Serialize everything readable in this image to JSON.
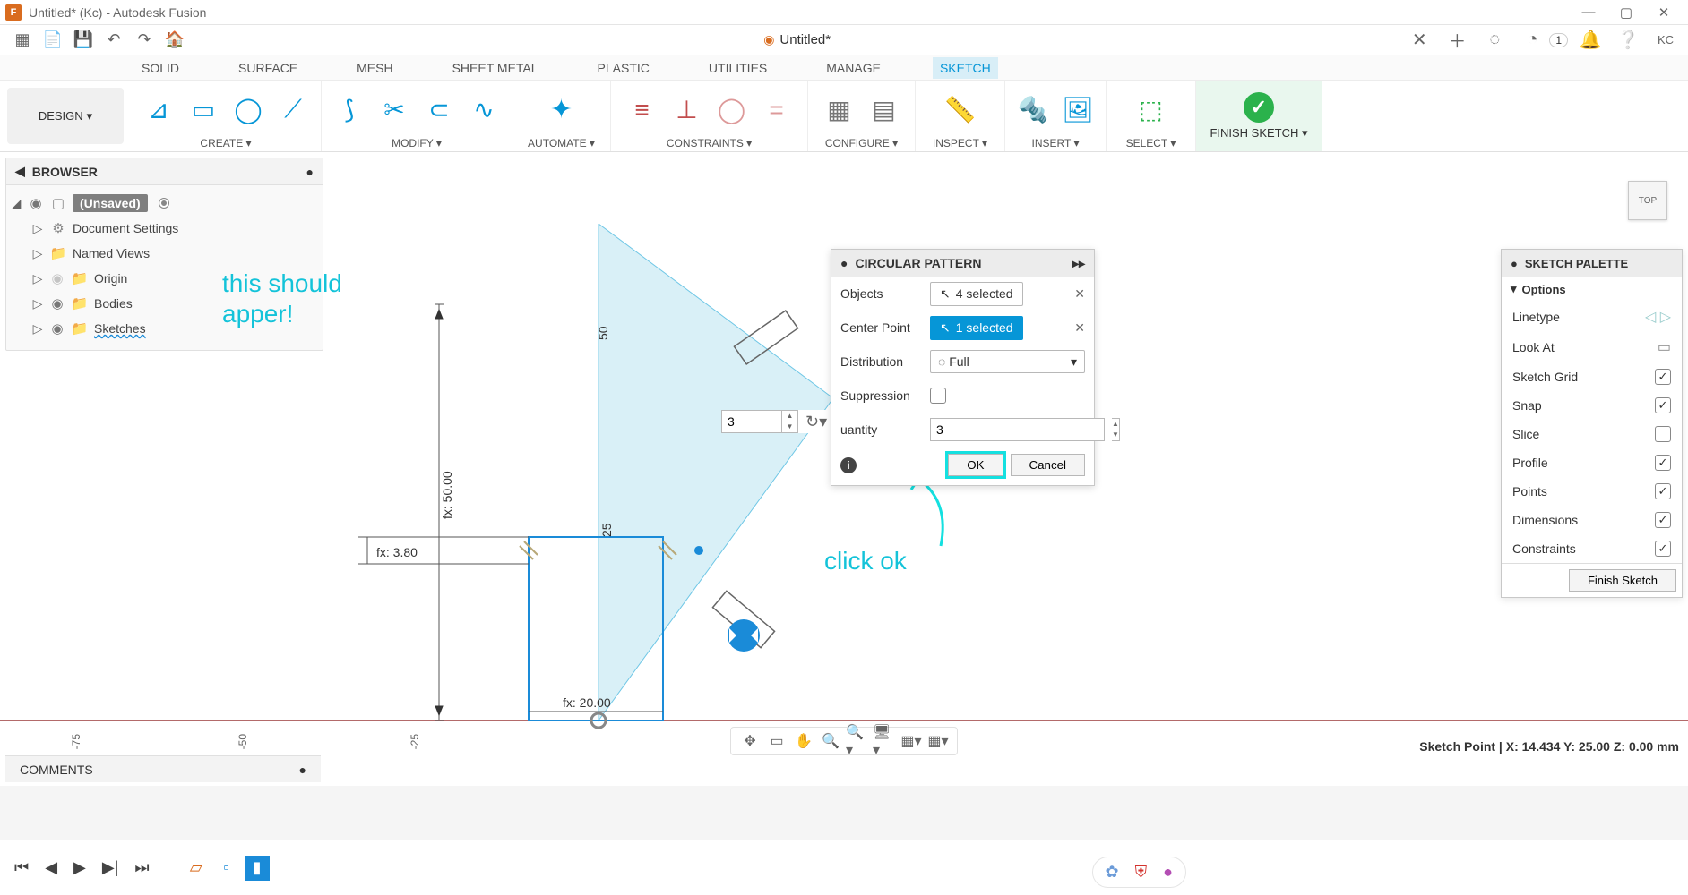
{
  "titlebar": {
    "title": "Untitled* (Kc) - Autodesk Fusion"
  },
  "qat": {
    "doc_tab": "Untitled*",
    "job_count": "1",
    "user": "KC"
  },
  "ribbon": {
    "workspace": "DESIGN",
    "tabs": [
      "SOLID",
      "SURFACE",
      "MESH",
      "SHEET METAL",
      "PLASTIC",
      "UTILITIES",
      "MANAGE",
      "SKETCH"
    ],
    "active_tab": "SKETCH",
    "groups": {
      "create": "CREATE",
      "modify": "MODIFY",
      "automate": "AUTOMATE",
      "constraints": "CONSTRAINTS",
      "configure": "CONFIGURE",
      "inspect": "INSPECT",
      "insert": "INSERT",
      "select": "SELECT",
      "finish": "FINISH SKETCH"
    }
  },
  "browser": {
    "title": "BROWSER",
    "root": "(Unsaved)",
    "items": [
      "Document Settings",
      "Named Views",
      "Origin",
      "Bodies",
      "Sketches"
    ]
  },
  "annotations": {
    "note1": "this should\napper!",
    "note2": "click ok"
  },
  "dimensions": {
    "d50v": "50",
    "d25v": "25",
    "fx50": "fx: 50.00",
    "fx38": "fx: 3.80",
    "fx20": "fx: 20.00"
  },
  "float_input": {
    "value": "3"
  },
  "panel": {
    "title": "CIRCULAR PATTERN",
    "rows": {
      "objects_label": "Objects",
      "objects_value": "4 selected",
      "center_label": "Center Point",
      "center_value": "1 selected",
      "dist_label": "Distribution",
      "dist_value": "Full",
      "suppress_label": "Suppression",
      "qty_label": "uantity",
      "qty_value": "3"
    },
    "ok": "OK",
    "cancel": "Cancel"
  },
  "palette": {
    "title": "SKETCH PALETTE",
    "section": "Options",
    "rows": [
      "Linetype",
      "Look At",
      "Sketch Grid",
      "Snap",
      "Slice",
      "Profile",
      "Points",
      "Dimensions",
      "Constraints"
    ],
    "checked": {
      "Sketch Grid": true,
      "Snap": true,
      "Profile": true,
      "Points": true,
      "Dimensions": true,
      "Constraints": true
    },
    "finish": "Finish Sketch"
  },
  "viewcube": "TOP",
  "ruler": {
    "m75": "-75",
    "m50": "-50",
    "m25": "-25"
  },
  "status": "Sketch Point | X: 14.434 Y: 25.00 Z: 0.00 mm",
  "comments": "COMMENTS"
}
